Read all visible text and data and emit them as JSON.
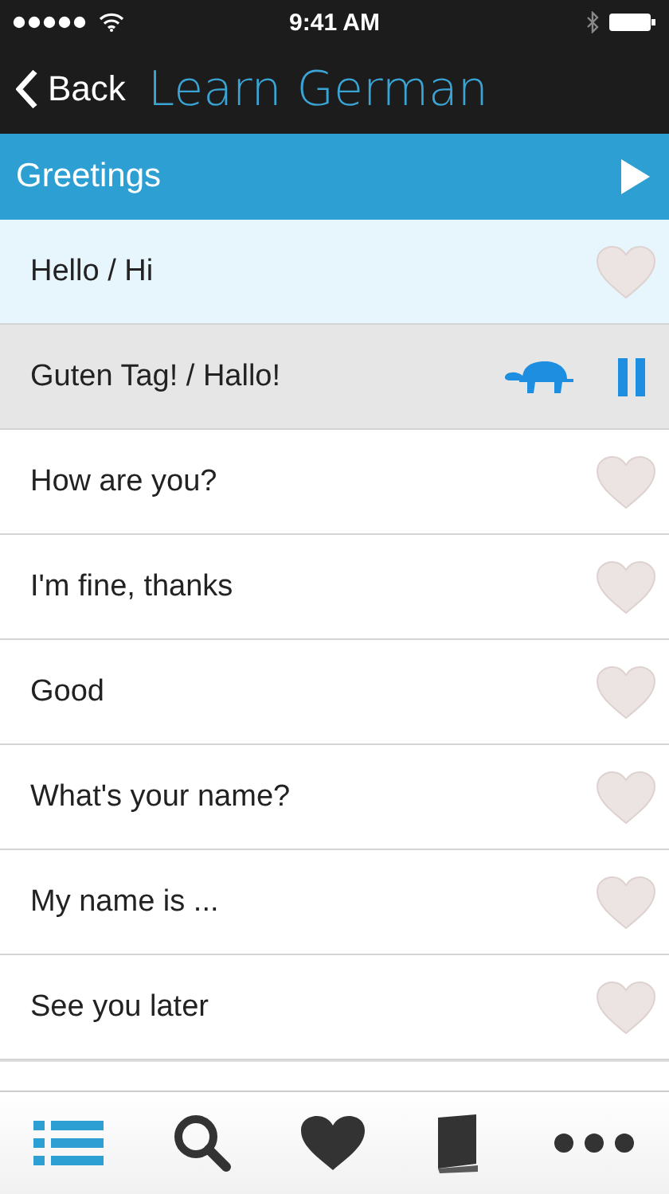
{
  "status_bar": {
    "time": "9:41 AM"
  },
  "nav": {
    "back": "Back",
    "title": "Learn German"
  },
  "section": {
    "title": "Greetings"
  },
  "phrases": [
    {
      "text": "Hello / Hi",
      "selected": true,
      "playing": false
    },
    {
      "text": "Guten Tag! / Hallo!",
      "selected": false,
      "playing": true
    },
    {
      "text": "How are you?",
      "selected": false,
      "playing": false
    },
    {
      "text": "I'm fine, thanks",
      "selected": false,
      "playing": false
    },
    {
      "text": "Good",
      "selected": false,
      "playing": false
    },
    {
      "text": "What's your name?",
      "selected": false,
      "playing": false
    },
    {
      "text": "My name is ...",
      "selected": false,
      "playing": false
    },
    {
      "text": "See you later",
      "selected": false,
      "playing": false
    }
  ],
  "tab_bar": [
    {
      "kind": "list",
      "selected": true
    },
    {
      "kind": "search",
      "selected": false
    },
    {
      "kind": "heart",
      "selected": false
    },
    {
      "kind": "book",
      "selected": false
    },
    {
      "kind": "more",
      "selected": false
    }
  ]
}
